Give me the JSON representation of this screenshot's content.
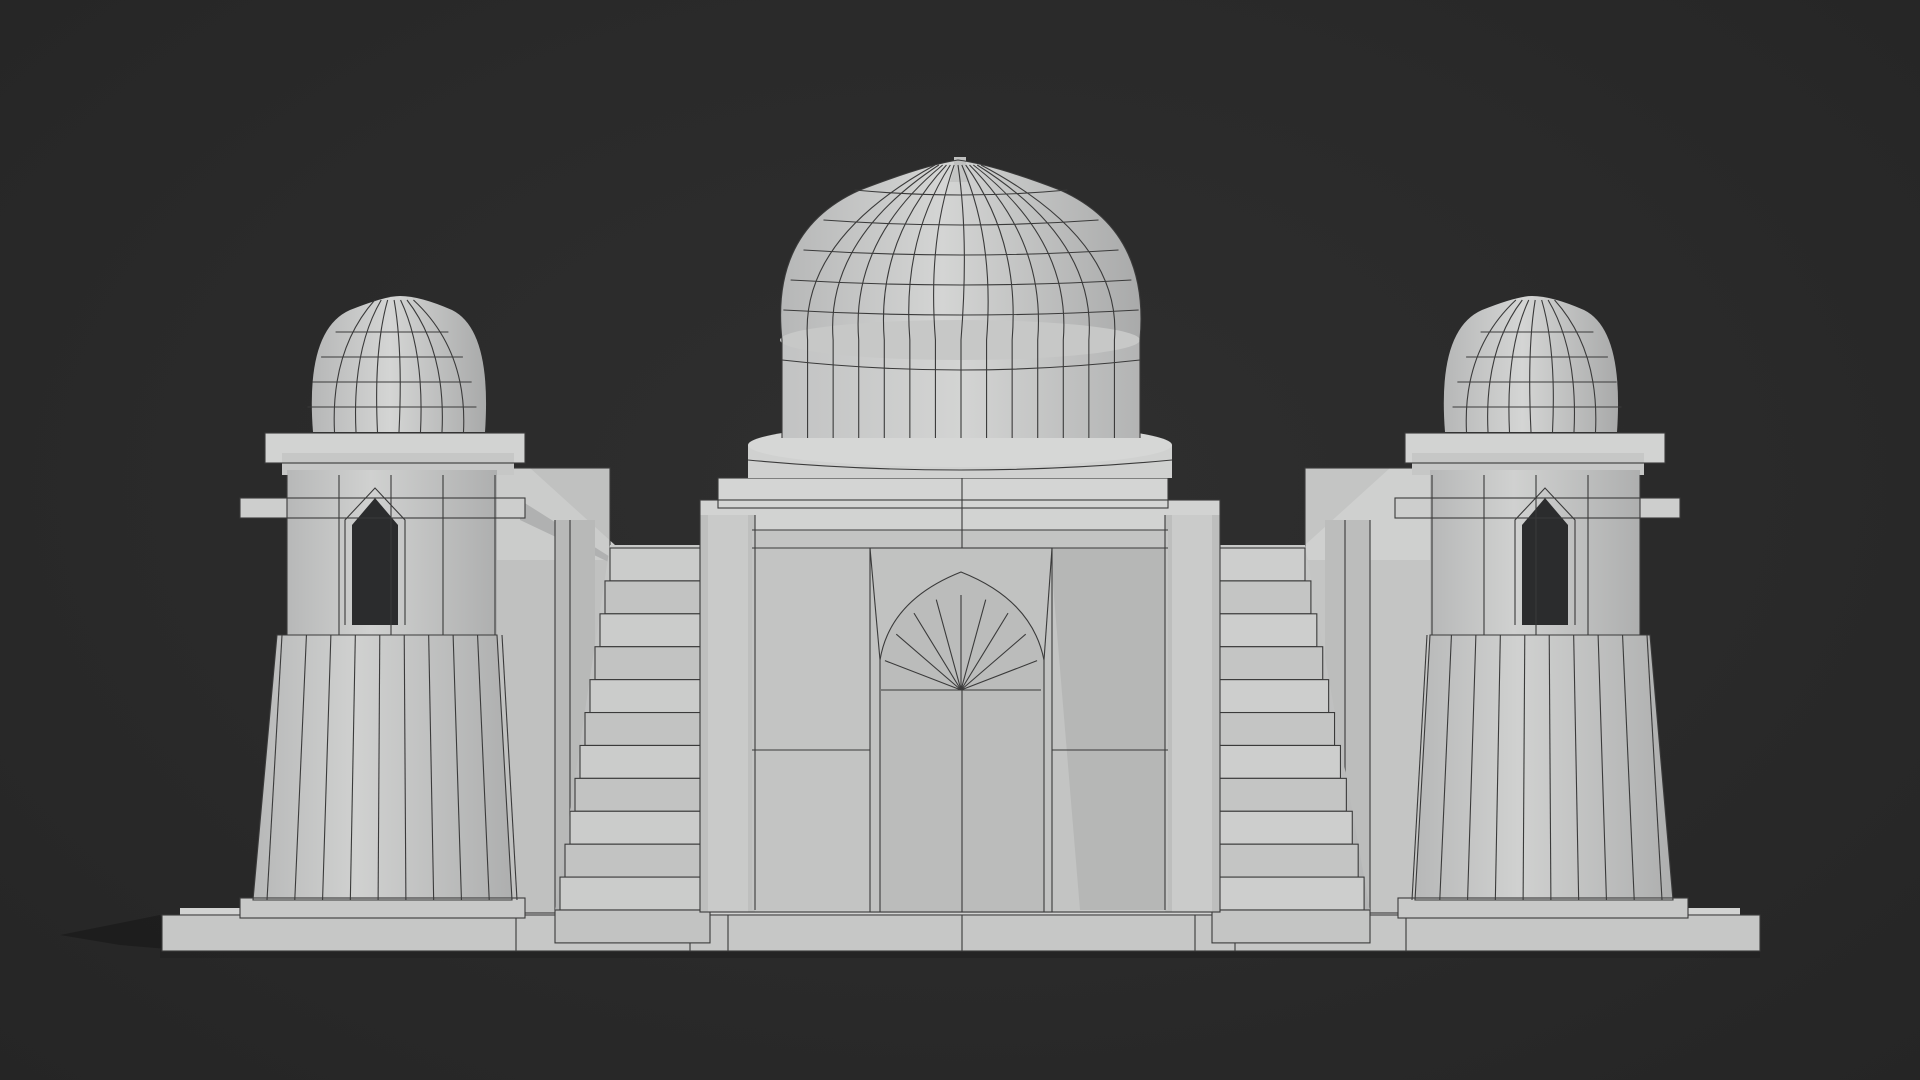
{
  "scene": {
    "subject": "mausoleum-3d-model",
    "render_mode": "clay-with-wireframe",
    "colors": {
      "background": "#2b2b2b",
      "clay_light": "#cfd0cf",
      "clay_mid": "#b9baba",
      "clay_shadow": "#9c9d9d",
      "wire": "#3a3a3a"
    }
  }
}
